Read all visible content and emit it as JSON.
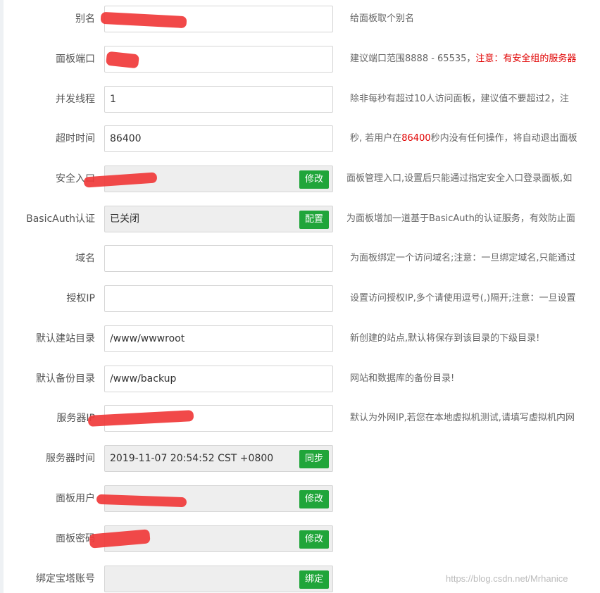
{
  "settings": {
    "alias": {
      "label": "别名",
      "hint": "给面板取个别名"
    },
    "port": {
      "label": "面板端口",
      "hint_prefix": "建议端口范围8888 - 65535，",
      "hint_warning": "注意：有安全组的服务器"
    },
    "threads": {
      "label": "并发线程",
      "value": "1",
      "hint": "除非每秒有超过10人访问面板，建议值不要超过2，注"
    },
    "timeout": {
      "label": "超时时间",
      "value": "86400",
      "hint_a": "秒, 若用户在",
      "hint_highlight": "86400",
      "hint_b": "秒内没有任何操作，将自动退出面板"
    },
    "security_entry": {
      "label": "安全入口",
      "button": "修改",
      "hint": "面板管理入口,设置后只能通过指定安全入口登录面板,如"
    },
    "basic_auth": {
      "label": "BasicAuth认证",
      "value": "已关闭",
      "button": "配置",
      "hint": "为面板增加一道基于BasicAuth的认证服务，有效防止面"
    },
    "domain": {
      "label": "域名",
      "hint": "为面板绑定一个访问域名;注意：一旦绑定域名,只能通过"
    },
    "auth_ip": {
      "label": "授权IP",
      "hint": "设置访问授权IP,多个请使用逗号(,)隔开;注意：一旦设置"
    },
    "site_dir": {
      "label": "默认建站目录",
      "value": "/www/wwwroot",
      "hint": "新创建的站点,默认将保存到该目录的下级目录!"
    },
    "backup_dir": {
      "label": "默认备份目录",
      "value": "/www/backup",
      "hint": "网站和数据库的备份目录!"
    },
    "server_ip": {
      "label": "服务器IP",
      "hint": "默认为外网IP,若您在本地虚拟机测试,请填写虚拟机内网"
    },
    "server_time": {
      "label": "服务器时间",
      "value": "2019-11-07 20:54:52 CST +0800",
      "button": "同步"
    },
    "panel_user": {
      "label": "面板用户",
      "button": "修改"
    },
    "panel_password": {
      "label": "面板密码",
      "button": "修改"
    },
    "bt_account": {
      "label": "绑定宝塔账号",
      "button": "绑定"
    }
  },
  "watermark": "https://blog.csdn.net/Mrhanice",
  "colors": {
    "button": "#20a53a",
    "warning": "#e00000",
    "redaction": "#f03a3a"
  }
}
